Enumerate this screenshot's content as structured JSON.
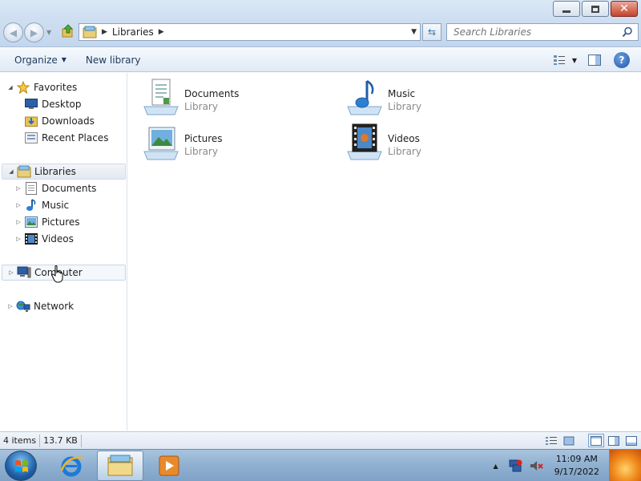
{
  "window": {
    "controls": {
      "minimize_icon": "minimize-icon",
      "maximize_icon": "restore-icon",
      "close_label": "✕"
    }
  },
  "nav": {
    "back_icon": "back-arrow-icon",
    "forward_icon": "forward-arrow-icon",
    "breadcrumb": [
      "Libraries"
    ],
    "search_placeholder": "Search Libraries"
  },
  "toolbar": {
    "organize_label": "Organize",
    "new_library_label": "New library"
  },
  "sidebar": {
    "favorites": {
      "label": "Favorites",
      "items": [
        {
          "label": "Desktop",
          "icon": "desktop-icon"
        },
        {
          "label": "Downloads",
          "icon": "downloads-folder-icon"
        },
        {
          "label": "Recent Places",
          "icon": "recent-places-icon"
        }
      ]
    },
    "libraries": {
      "label": "Libraries",
      "items": [
        {
          "label": "Documents",
          "icon": "documents-icon"
        },
        {
          "label": "Music",
          "icon": "music-icon"
        },
        {
          "label": "Pictures",
          "icon": "pictures-icon"
        },
        {
          "label": "Videos",
          "icon": "videos-icon"
        }
      ]
    },
    "computer": {
      "label": "Computer"
    },
    "network": {
      "label": "Network"
    }
  },
  "content": {
    "libraries": [
      {
        "name": "Documents",
        "sub": "Library",
        "icon": "documents-library-icon"
      },
      {
        "name": "Music",
        "sub": "Library",
        "icon": "music-library-icon"
      },
      {
        "name": "Pictures",
        "sub": "Library",
        "icon": "pictures-library-icon"
      },
      {
        "name": "Videos",
        "sub": "Library",
        "icon": "videos-library-icon"
      }
    ]
  },
  "status": {
    "count": "4 items",
    "size": "13.7 KB"
  },
  "taskbar": {
    "time": "11:09 AM",
    "date": "9/17/2022"
  },
  "colors": {
    "accent": "#3f7bbd",
    "titlebar": "#cfdff1",
    "close": "#c6442a"
  }
}
